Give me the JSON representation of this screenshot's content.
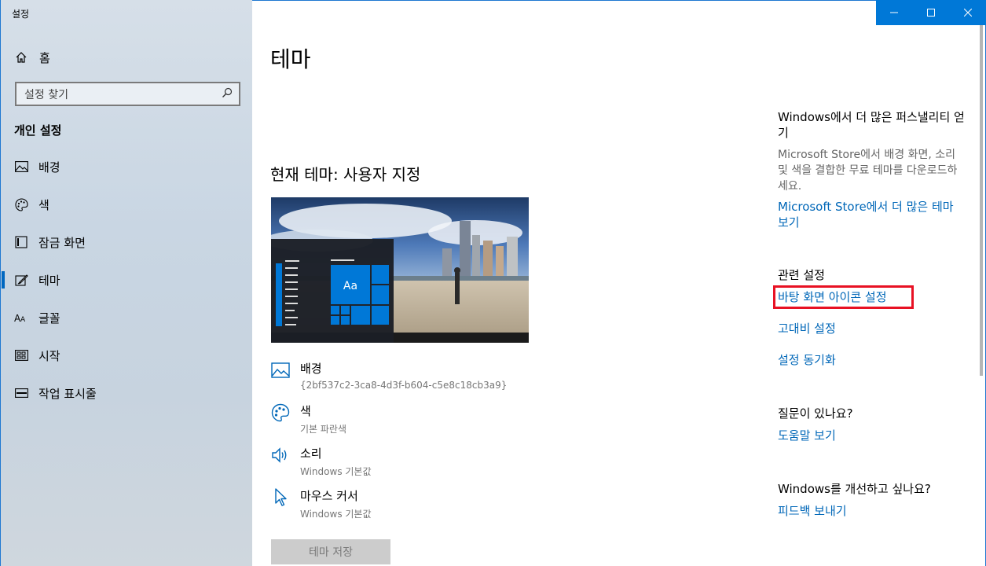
{
  "window": {
    "title": "설정"
  },
  "sidebar": {
    "home_label": "홈",
    "search_placeholder": "설정 찾기",
    "section_title": "개인 설정",
    "items": [
      {
        "label": "배경",
        "icon": "picture-icon"
      },
      {
        "label": "색",
        "icon": "palette-icon"
      },
      {
        "label": "잠금 화면",
        "icon": "lock-screen-icon"
      },
      {
        "label": "테마",
        "icon": "theme-brush-icon",
        "active": true
      },
      {
        "label": "글꼴",
        "icon": "font-icon"
      },
      {
        "label": "시작",
        "icon": "start-icon"
      },
      {
        "label": "작업 표시줄",
        "icon": "taskbar-icon"
      }
    ]
  },
  "main": {
    "page_title": "테마",
    "current_theme": "현재 테마: 사용자 지정",
    "preview": {
      "sample_text": "Aa"
    },
    "properties": [
      {
        "label": "배경",
        "value": "{2bf537c2-3ca8-4d3f-b604-c5e8c18cb3a9}",
        "icon": "picture-icon"
      },
      {
        "label": "색",
        "value": "기본 파란색",
        "icon": "palette-icon"
      },
      {
        "label": "소리",
        "value": "Windows 기본값",
        "icon": "speaker-icon"
      },
      {
        "label": "마우스 커서",
        "value": "Windows 기본값",
        "icon": "cursor-icon"
      }
    ],
    "save_button": "테마 저장"
  },
  "right": {
    "store_heading": "Windows에서 더 많은 퍼스낼리티 얻기",
    "store_text": "Microsoft Store에서 배경 화면, 소리 및 색을 결합한 무료 테마를 다운로드하세요.",
    "store_link": "Microsoft Store에서 더 많은 테마 보기",
    "related_heading": "관련 설정",
    "related_links": [
      "바탕 화면 아이콘 설정",
      "고대비 설정",
      "설정 동기화"
    ],
    "question_heading": "질문이 있나요?",
    "help_link": "도움말 보기",
    "improve_heading": "Windows를 개선하고 싶나요?",
    "feedback_link": "피드백 보내기"
  },
  "colors": {
    "accent": "#0078d7",
    "link": "#0067b8",
    "highlight": "#e81123"
  }
}
